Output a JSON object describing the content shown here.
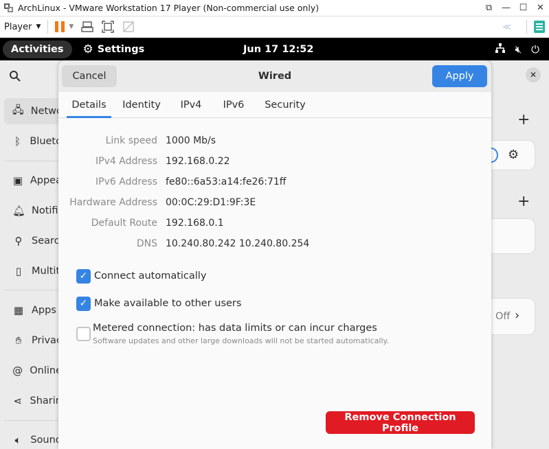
{
  "vmware": {
    "title": "ArchLinux - VMware Workstation 17 Player (Non-commercial use only)",
    "window_buttons": [
      "⧉",
      "—",
      "☐",
      "✕"
    ],
    "player_label": "Player"
  },
  "gnome": {
    "activities": "Activities",
    "app_name": "Settings",
    "clock": "Jun 17  12:52"
  },
  "sidebar": {
    "items": [
      {
        "label": "Netwo",
        "icon": "network-icon"
      },
      {
        "label": "Blueto",
        "icon": "bluetooth-icon"
      },
      {
        "label": "Appea",
        "icon": "appearance-icon"
      },
      {
        "label": "Notifi",
        "icon": "bell-icon"
      },
      {
        "label": "Searc",
        "icon": "search-icon"
      },
      {
        "label": "Multit",
        "icon": "multitasking-icon"
      },
      {
        "label": "Apps",
        "icon": "apps-icon"
      },
      {
        "label": "Privac",
        "icon": "hand-icon"
      },
      {
        "label": "Online",
        "icon": "at-icon"
      },
      {
        "label": "Sharin",
        "icon": "share-icon"
      },
      {
        "label": "Sound",
        "icon": "speaker-icon"
      }
    ]
  },
  "background_panel": {
    "off_label": "Off"
  },
  "dialog": {
    "cancel_label": "Cancel",
    "title": "Wired",
    "apply_label": "Apply",
    "tabs": [
      "Details",
      "Identity",
      "IPv4",
      "IPv6",
      "Security"
    ],
    "active_tab": "Details",
    "details": [
      {
        "label": "Link speed",
        "value": "1000 Mb/s"
      },
      {
        "label": "IPv4 Address",
        "value": "192.168.0.22"
      },
      {
        "label": "IPv6 Address",
        "value": "fe80::6a53:a14:fe26:71ff"
      },
      {
        "label": "Hardware Address",
        "value": "00:0C:29:D1:9F:3E"
      },
      {
        "label": "Default Route",
        "value": "192.168.0.1"
      },
      {
        "label": "DNS",
        "value": "10.240.80.242 10.240.80.254"
      }
    ],
    "connect_automatically": {
      "label": "Connect automatically",
      "checked": true
    },
    "available_to_others": {
      "label": "Make available to other users",
      "checked": true
    },
    "metered": {
      "label": "Metered connection: has data limits or can incur charges",
      "sublabel": "Software updates and other large downloads will not be started automatically.",
      "checked": false
    },
    "remove_label": "Remove Connection Profile"
  },
  "colors": {
    "accent": "#3584e4",
    "destructive": "#e01b24",
    "vmware_pause": "#f07a1a"
  }
}
